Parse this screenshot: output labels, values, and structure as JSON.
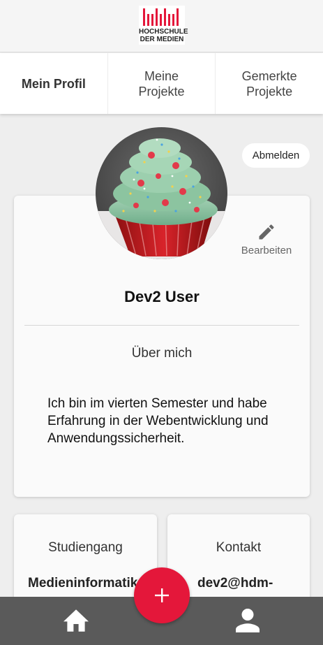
{
  "header": {
    "logo_line1": "HOCHSCHULE",
    "logo_line2": "DER MEDIEN",
    "brand_color": "#e4173a"
  },
  "tabs": [
    {
      "label": "Mein Profil",
      "active": true
    },
    {
      "label": "Meine\nProjekte",
      "active": false
    },
    {
      "label": "Gemerkte\nProjekte",
      "active": false
    }
  ],
  "logout_label": "Abmelden",
  "profile": {
    "avatar_icon": "cupcake-photo",
    "edit_label": "Bearbeiten",
    "edit_icon": "pencil-icon",
    "name": "Dev2 User",
    "about_title": "Über mich",
    "about_text": "Ich bin im vierten Semester und habe Erfahrung in der Webentwicklung und Anwendungssicherheit."
  },
  "study": {
    "title": "Studiengang",
    "value": "Medieninformatik"
  },
  "contact": {
    "title": "Kontakt",
    "value": "dev2@hdm-"
  },
  "bottom_nav": {
    "home_icon": "home-icon",
    "fab_icon": "plus-icon",
    "profile_icon": "user-icon"
  }
}
